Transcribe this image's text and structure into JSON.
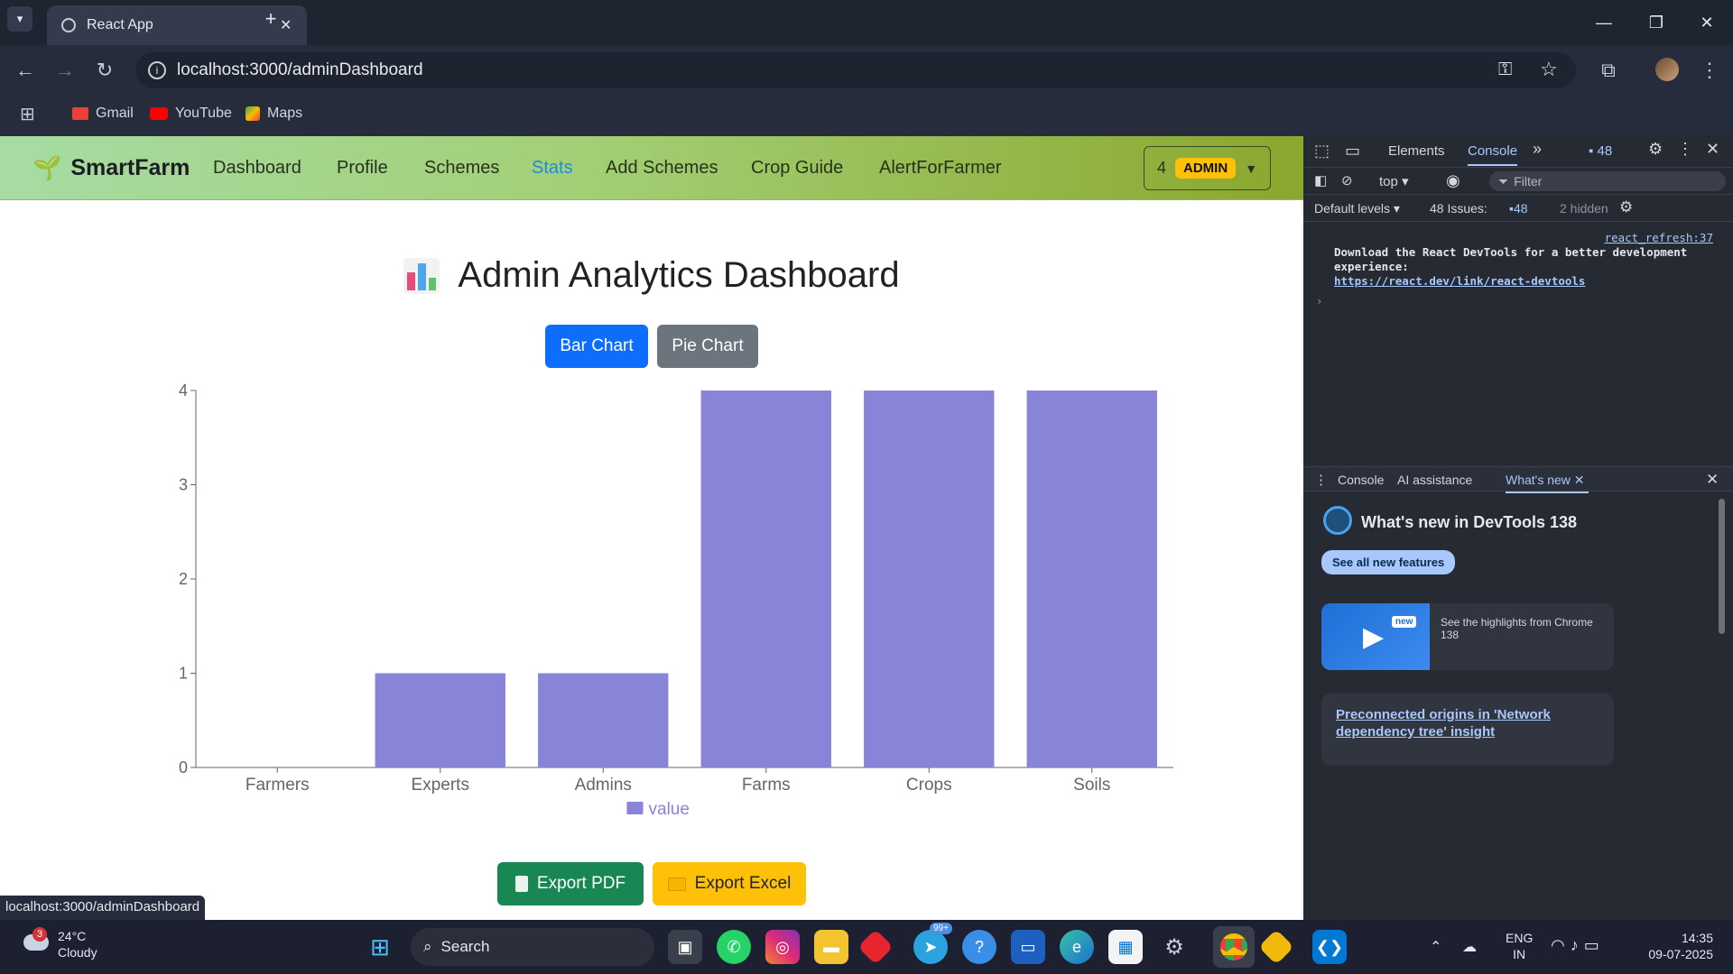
{
  "browser": {
    "tab_title": "React App",
    "url": "localhost:3000/adminDashboard",
    "bookmarks": [
      "Gmail",
      "YouTube",
      "Maps"
    ],
    "status_url": "localhost:3000/adminDashboard"
  },
  "app": {
    "brand": "SmartFarm",
    "nav": [
      "Dashboard",
      "Profile",
      "Schemes",
      "Stats",
      "Add Schemes",
      "Crop Guide",
      "AlertForFarmer"
    ],
    "active_nav": "Stats",
    "user_id": "4",
    "role_badge": "ADMIN",
    "heading": "Admin Analytics Dashboard",
    "toggle_bar": "Bar Chart",
    "toggle_pie": "Pie Chart",
    "export_pdf": "Export PDF",
    "export_excel": "Export Excel"
  },
  "chart_data": {
    "type": "bar",
    "categories": [
      "Farmers",
      "Experts",
      "Admins",
      "Farms",
      "Crops",
      "Soils"
    ],
    "series": [
      {
        "name": "value",
        "values": [
          0,
          1,
          1,
          4,
          4,
          4
        ]
      }
    ],
    "ylim": [
      0,
      4
    ],
    "yticks": [
      "0",
      "1",
      "2",
      "3",
      "4"
    ],
    "legend": "value",
    "legend_position": "bottom-center",
    "bar_color": "#8884d8"
  },
  "devtools": {
    "tabs": [
      "Elements",
      "Console"
    ],
    "issue_count": "48",
    "context": "top",
    "filter_placeholder": "Filter",
    "levels": "Default levels",
    "issues_label": "48 Issues:",
    "issues_badge": "48",
    "hidden": "2 hidden",
    "console_source": "react_refresh:37",
    "console_msg": "Download the React DevTools for a better development experience:",
    "console_link": "https://react.dev/link/react-devtools",
    "drawer_tabs": [
      "Console",
      "AI assistance",
      "What's new"
    ],
    "whatsnew_title": "What's new in DevTools 138",
    "see_all": "See all new features",
    "new_badge": "new",
    "highlights": "See the highlights from Chrome 138",
    "preconnect": "Preconnected origins in 'Network dependency tree' insight"
  },
  "taskbar": {
    "weather_badge": "3",
    "temp": "24°C",
    "condition": "Cloudy",
    "search": "Search",
    "telegram_badge": "99+",
    "lang1": "ENG",
    "lang2": "IN",
    "time": "14:35",
    "date": "09-07-2025"
  }
}
